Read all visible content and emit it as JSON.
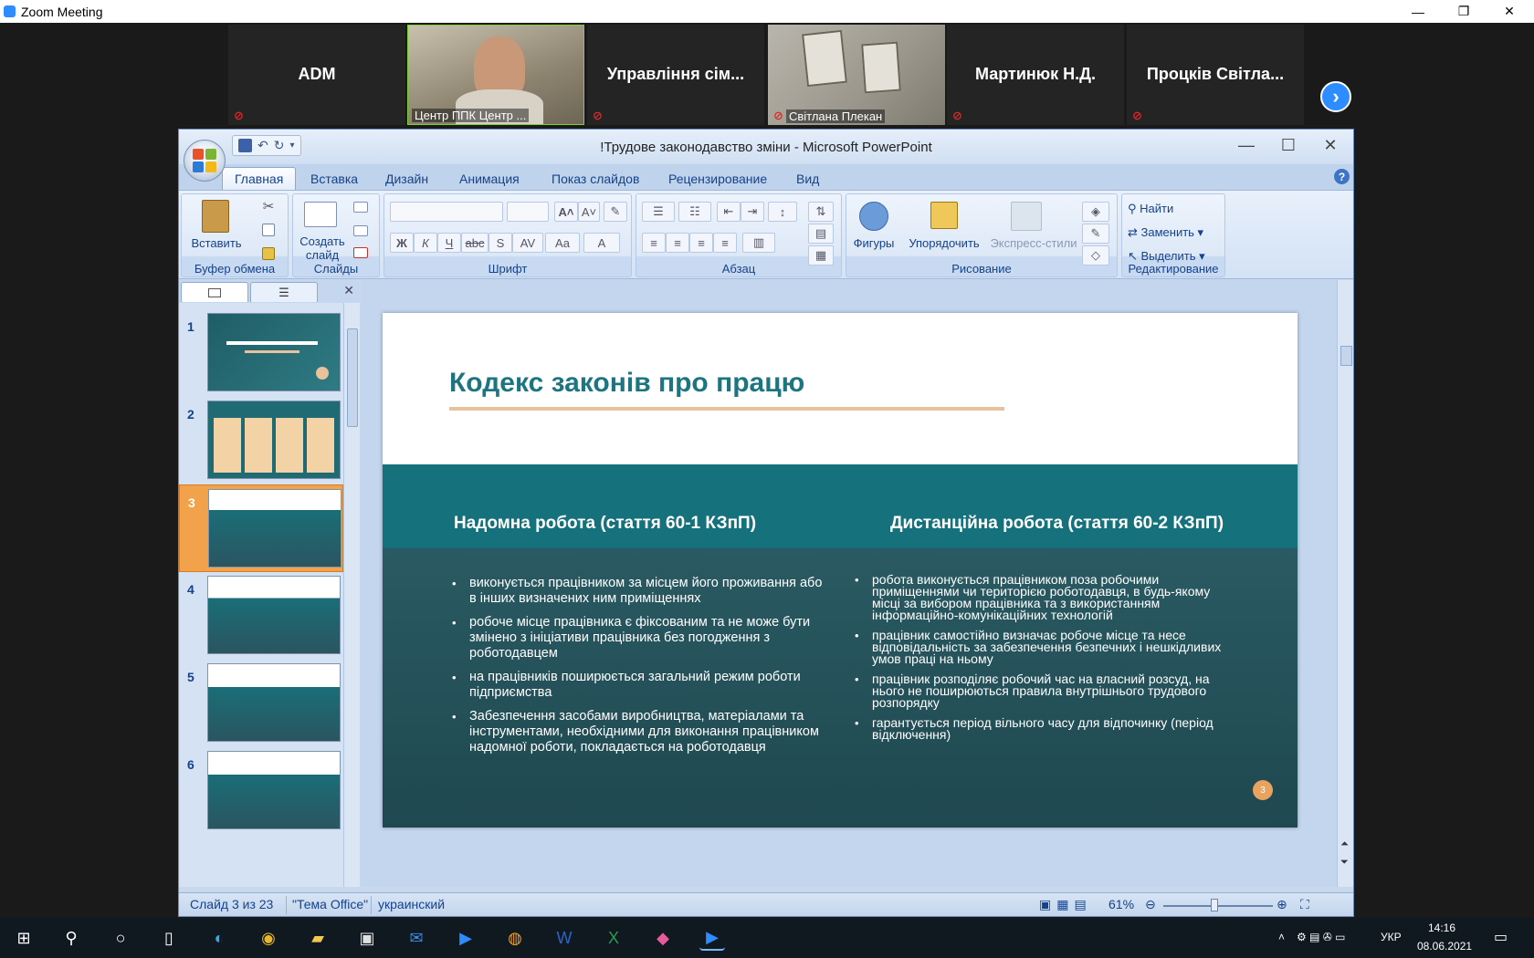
{
  "zoom": {
    "window_title": "Zoom Meeting",
    "participants": [
      {
        "name": "ADM",
        "video": false
      },
      {
        "name": "Центр ППК Центр ...",
        "video": true,
        "active": true
      },
      {
        "name": "Управління сім...",
        "video": false
      },
      {
        "name": "Світлана Плекан",
        "video": true
      },
      {
        "name": "Мартинюк Н.Д.",
        "video": false
      },
      {
        "name": "Процків Світла...",
        "video": false
      }
    ],
    "next_icon": "chevron-right-icon"
  },
  "ppt": {
    "title": "!Трудове законодавство зміни - Microsoft PowerPoint",
    "tabs": [
      "Главная",
      "Вставка",
      "Дизайн",
      "Анимация",
      "Показ слайдов",
      "Рецензирование",
      "Вид"
    ],
    "active_tab": "Главная",
    "ribbon": {
      "clipboard": {
        "paste": "Вставить",
        "label": "Буфер обмена"
      },
      "slides": {
        "new_slide_line1": "Создать",
        "new_slide_line2": "слайд",
        "label": "Слайды"
      },
      "font": {
        "label": "Шрифт",
        "bold": "Ж",
        "italic": "К",
        "underline": "Ч",
        "strike": "abc",
        "shadow": "S",
        "spacing": "AV",
        "case": "Aa",
        "color": "A"
      },
      "paragraph": {
        "label": "Абзац"
      },
      "drawing": {
        "shapes": "Фигуры",
        "arrange": "Упорядочить",
        "quick_styles": "Экспресс-стили",
        "label": "Рисование"
      },
      "editing": {
        "find": "Найти",
        "replace": "Заменить",
        "select": "Выделить",
        "label": "Редактирование"
      }
    },
    "thumbnails": [
      "1",
      "2",
      "3",
      "4",
      "5",
      "6"
    ],
    "selected_slide": "3",
    "slide": {
      "title": "Кодекс законів про працю",
      "left_heading": "Надомна робота (стаття 60-1 КЗпП)",
      "right_heading": "Дистанційна робота (стаття 60-2 КЗпП)",
      "left_bullets": [
        "виконується працівником за місцем його проживання або в інших визначених ним приміщеннях",
        "робоче місце працівника є фіксованим та не може бути змінено з ініціативи працівника без погодження з роботодавцем",
        "на працівників поширюється загальний режим роботи підприємства",
        "Забезпечення засобами виробництва, матеріалами та інструментами, необхідними для виконання працівником надомної роботи, покладається на роботодавця"
      ],
      "right_bullets": [
        "робота виконується працівником поза робочими приміщеннями чи територією роботодавця, в будь-якому місці за вибором працівника та з використанням інформаційно-комунікаційних технологій",
        "працівник самостійно визначає робоче місце та несе відповідальність за забезпечення безпечних і нешкідливих умов праці на ньому",
        "працівник розподіляє робочий час на власний розсуд, на нього не поширюються правила внутрішнього трудового розпорядку",
        "гарантується період вільного часу для відпочинку (період відключення)"
      ],
      "page_number": "3"
    },
    "status": {
      "slide_info": "Слайд 3 из 23",
      "theme": "\"Тема Office\"",
      "language": "украинский",
      "zoom": "61%"
    }
  },
  "taskbar": {
    "lang": "УКР",
    "time": "14:16",
    "date": "08.06.2021"
  },
  "colors": {
    "slide_teal": "#15727d",
    "title_teal": "#1c7580",
    "accent_orange": "#f2a24b"
  }
}
